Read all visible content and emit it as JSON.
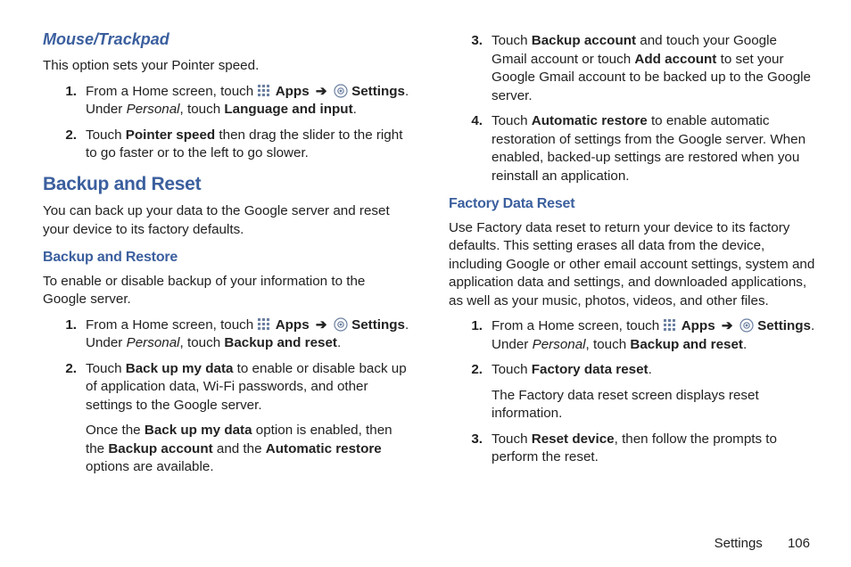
{
  "col1": {
    "mouseTrackpad": {
      "title": "Mouse/Trackpad",
      "intro": "This option sets your Pointer speed.",
      "steps": [
        {
          "n": "1.",
          "pre": "From a Home screen, touch ",
          "apps": "Apps",
          "arrow": "➔",
          "settings": "Settings",
          "after": ". Under ",
          "personal": "Personal",
          "after2": ", touch ",
          "bold2": "Language and input",
          "end": "."
        },
        {
          "n": "2.",
          "pre": "Touch ",
          "bold": "Pointer speed",
          "after": " then drag the slider to the right to go faster or to the left to go slower."
        }
      ]
    },
    "backupReset": {
      "title": "Backup and Reset",
      "intro": "You can back up your data to the Google server and reset your device to its factory defaults."
    },
    "backupRestore": {
      "title": "Backup and Restore",
      "intro": "To enable or disable backup of your information to the Google server.",
      "steps": [
        {
          "n": "1.",
          "pre": "From a Home screen, touch ",
          "apps": "Apps",
          "arrow": "➔",
          "settings": "Settings",
          "after": ". Under ",
          "personal": "Personal",
          "after2": ", touch ",
          "bold2": "Backup and reset",
          "end": "."
        },
        {
          "n": "2.",
          "pre": "Touch ",
          "bold": "Back up my data",
          "after": " to enable or disable back up of application data, Wi-Fi passwords, and other settings to the Google server.",
          "cont_pre": "Once the ",
          "cont_b1": "Back up my data",
          "cont_mid": " option is enabled, then the ",
          "cont_b2": "Backup account",
          "cont_mid2": " and the ",
          "cont_b3": "Automatic restore",
          "cont_end": " options are available."
        }
      ]
    }
  },
  "col2": {
    "topSteps": [
      {
        "n": "3.",
        "pre": "Touch ",
        "b1": "Backup account",
        "mid": " and touch your Google Gmail account or touch ",
        "b2": "Add account",
        "end": " to set your Google Gmail account to be backed up to the Google server."
      },
      {
        "n": "4.",
        "pre": "Touch ",
        "b1": "Automatic restore",
        "end": " to enable automatic restoration of settings from the Google server. When enabled, backed-up settings are restored when you reinstall an application."
      }
    ],
    "factory": {
      "title": "Factory Data Reset",
      "intro": "Use Factory data reset to return your device to its factory defaults. This setting erases all data from the device, including Google or other email account settings, system and application data and settings, and downloaded applications, as well as your music, photos, videos, and other files.",
      "steps": [
        {
          "n": "1.",
          "pre": "From a Home screen, touch ",
          "apps": "Apps",
          "arrow": "➔",
          "settings": "Settings",
          "after": ". Under ",
          "personal": "Personal",
          "after2": ", touch ",
          "bold2": "Backup and reset",
          "end": "."
        },
        {
          "n": "2.",
          "pre": "Touch ",
          "bold": "Factory data reset",
          "after": ".",
          "cont": "The Factory data reset screen displays reset information."
        },
        {
          "n": "3.",
          "pre": "Touch ",
          "bold": "Reset device",
          "after": ", then follow the prompts to perform the reset."
        }
      ]
    }
  },
  "footer": {
    "section": "Settings",
    "page": "106"
  }
}
